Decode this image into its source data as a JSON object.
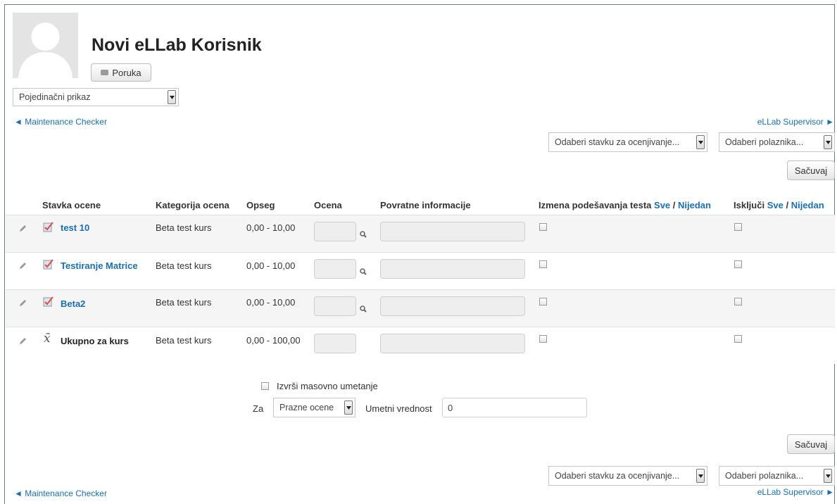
{
  "profile": {
    "name": "Novi eLLab Korisnik",
    "message_button": "Poruka"
  },
  "view_select": {
    "value": "Pojedinačni prikaz"
  },
  "nav": {
    "prev": "◄ Maintenance Checker",
    "next": "eLLab Supervisor ►"
  },
  "selectors": {
    "item_placeholder": "Odaberi stavku za ocenjivanje...",
    "student_placeholder": "Odaberi polaznika..."
  },
  "save_label": "Sačuvaj",
  "table": {
    "headers": {
      "item": "Stavka ocene",
      "category": "Kategorija ocena",
      "range": "Opseg",
      "grade": "Ocena",
      "feedback": "Povratne informacije",
      "override": "Izmena podešavanja testa",
      "exclude": "Isključi",
      "all": "Sve",
      "sep": " / ",
      "none": "Nijedan"
    },
    "rows": [
      {
        "name": "test 10",
        "category": "Beta test kurs",
        "range": "0,00 - 10,00",
        "icon": "quiz-icon"
      },
      {
        "name": "Testiranje Matrice",
        "category": "Beta test kurs",
        "range": "0,00 - 10,00",
        "icon": "quiz-icon"
      },
      {
        "name": "Beta2",
        "category": "Beta test kurs",
        "range": "0,00 - 10,00",
        "icon": "quiz-icon"
      },
      {
        "name": "Ukupno za kurs",
        "category": "Beta test kurs",
        "range": "0,00 - 100,00",
        "icon": "course-total-icon"
      }
    ]
  },
  "bulk": {
    "checkbox_label": "Izvrši masovno umetanje",
    "for_label": "Za",
    "for_value": "Prazne ocene",
    "insert_label": "Umetni vrednost",
    "insert_value": "0"
  },
  "colors": {
    "link": "#1a6fb0",
    "row_alt": "#f5f5f5",
    "check": "#d9534f"
  }
}
